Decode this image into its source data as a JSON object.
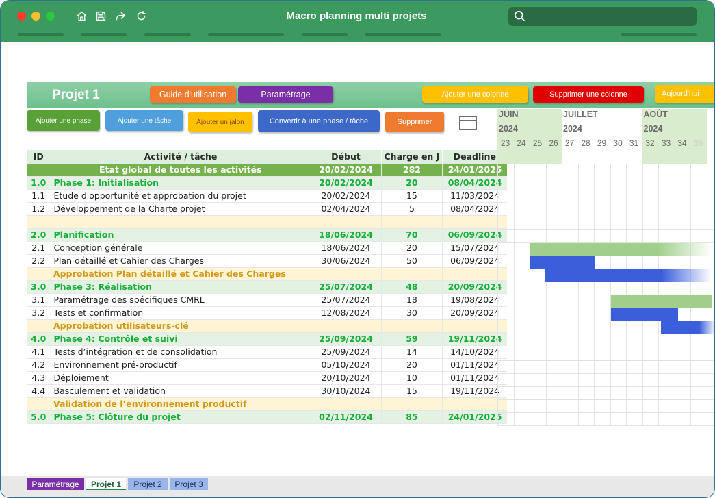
{
  "window": {
    "title": "Macro planning multi projets",
    "search_placeholder": ""
  },
  "sheet": {
    "project_title": "Projet 1",
    "top_buttons": {
      "guide": "Guide d'utilisation",
      "settings": "Paramétrage",
      "add_column": "Ajouter une colonne",
      "delete_column": "Supprimer une colonne",
      "today": "Aujourd'hui"
    },
    "action_buttons": {
      "add_phase": "Ajouter une phase",
      "add_task": "Ajouter une tâche",
      "add_milestone": "Ajouter un jalon",
      "convert": "Convertir à une phase / tâche",
      "delete": "Supprimer"
    },
    "table": {
      "headers": [
        "ID",
        "Activité / tâche",
        "Début",
        "Charge en J",
        "Deadline"
      ],
      "rows": [
        {
          "type": "global",
          "id": "",
          "activity": "Etat global de toutes les activités",
          "start": "20/02/2024",
          "load": "282",
          "deadline": "24/01/2025"
        },
        {
          "type": "phase",
          "id": "1.0",
          "activity": "Phase 1: Initialisation",
          "start": "20/02/2024",
          "load": "20",
          "deadline": "08/04/2024"
        },
        {
          "type": "task",
          "id": "1.1",
          "activity": "Etude d'opportunité et approbation du projet",
          "start": "20/02/2024",
          "load": "15",
          "deadline": "11/03/2024"
        },
        {
          "type": "task",
          "id": "1.2",
          "activity": "Développement de la Charte projet",
          "start": "02/04/2024",
          "load": "5",
          "deadline": "08/04/2024"
        },
        {
          "type": "empty",
          "id": "",
          "activity": "",
          "start": "",
          "load": "",
          "deadline": ""
        },
        {
          "type": "phase",
          "id": "2.0",
          "activity": "Planification",
          "start": "18/06/2024",
          "load": "70",
          "deadline": "06/09/2024"
        },
        {
          "type": "task",
          "id": "2.1",
          "activity": "Conception générale",
          "start": "18/06/2024",
          "load": "20",
          "deadline": "15/07/2024"
        },
        {
          "type": "task",
          "id": "2.2",
          "activity": "Plan détaillé et Cahier des Charges",
          "start": "30/06/2024",
          "load": "50",
          "deadline": "06/09/2024"
        },
        {
          "type": "milestone",
          "id": "",
          "activity": "Approbation Plan détaillé et Cahier des Charges",
          "start": "",
          "load": "",
          "deadline": ""
        },
        {
          "type": "phase",
          "id": "3.0",
          "activity": "Phase 3: Réalisation",
          "start": "25/07/2024",
          "load": "48",
          "deadline": "20/09/2024"
        },
        {
          "type": "task",
          "id": "3.1",
          "activity": "Paramétrage des spécifiques CMRL",
          "start": "25/07/2024",
          "load": "18",
          "deadline": "19/08/2024"
        },
        {
          "type": "task",
          "id": "3.2",
          "activity": "Tests et confirmation",
          "start": "12/08/2024",
          "load": "30",
          "deadline": "20/09/2024"
        },
        {
          "type": "milestone",
          "id": "",
          "activity": "Approbation utilisateurs-clé",
          "start": "",
          "load": "",
          "deadline": ""
        },
        {
          "type": "phase",
          "id": "4.0",
          "activity": "Phase 4: Contrôle et suivi",
          "start": "25/09/2024",
          "load": "59",
          "deadline": "19/11/2024"
        },
        {
          "type": "task",
          "id": "4.1",
          "activity": "Tests d’intégration et de consolidation",
          "start": "25/09/2024",
          "load": "14",
          "deadline": "14/10/2024"
        },
        {
          "type": "task",
          "id": "4.2",
          "activity": "Environnement pré-productif",
          "start": "05/10/2024",
          "load": "20",
          "deadline": "01/11/2024"
        },
        {
          "type": "task",
          "id": "4.3",
          "activity": "Déploiement",
          "start": "20/10/2024",
          "load": "10",
          "deadline": "01/11/2024"
        },
        {
          "type": "task",
          "id": "4.4",
          "activity": "Basculement et validation",
          "start": "30/10/2024",
          "load": "15",
          "deadline": "19/11/2024"
        },
        {
          "type": "milestone",
          "id": "",
          "activity": "Validation de l’environnement productif",
          "start": "",
          "load": "",
          "deadline": ""
        },
        {
          "type": "phase",
          "id": "5.0",
          "activity": "Phase 5: Clôture du projet",
          "start": "02/11/2024",
          "load": "85",
          "deadline": "24/01/2025"
        }
      ]
    },
    "gantt": {
      "months": [
        {
          "name": "JUIN",
          "year": "2024"
        },
        {
          "name": "JUILLET",
          "year": "2024"
        },
        {
          "name": "AOÛT",
          "year": "2024"
        }
      ],
      "weeks": [
        "23",
        "24",
        "25",
        "26",
        "27",
        "28",
        "29",
        "30",
        "31",
        "32",
        "33",
        "34",
        "35"
      ],
      "colors": {
        "phase_bar": "#9fcf8a",
        "task_bar": "#3b5fdb",
        "today_line": "#e57b4a"
      }
    }
  },
  "sheet_tabs": [
    "Paramétrage",
    "Projet 1",
    "Projet 2",
    "Projet 3"
  ],
  "active_tab": "Projet 1"
}
